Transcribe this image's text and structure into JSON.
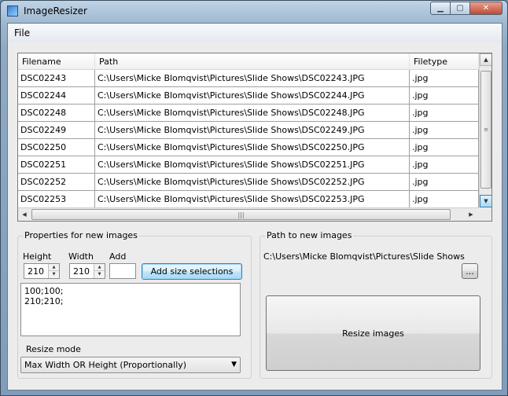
{
  "window": {
    "title": "ImageResizer",
    "min_glyph": "▁",
    "max_glyph": "▢",
    "close_glyph": "✕"
  },
  "menu": {
    "file_label": "File"
  },
  "grid": {
    "columns": [
      "Filename",
      "Path",
      "Filetype"
    ],
    "rows": [
      [
        "DSC02243",
        "C:\\Users\\Micke Blomqvist\\Pictures\\Slide Shows\\DSC02243.JPG",
        ".jpg"
      ],
      [
        "DSC02244",
        "C:\\Users\\Micke Blomqvist\\Pictures\\Slide Shows\\DSC02244.JPG",
        ".jpg"
      ],
      [
        "DSC02248",
        "C:\\Users\\Micke Blomqvist\\Pictures\\Slide Shows\\DSC02248.JPG",
        ".jpg"
      ],
      [
        "DSC02249",
        "C:\\Users\\Micke Blomqvist\\Pictures\\Slide Shows\\DSC02249.JPG",
        ".jpg"
      ],
      [
        "DSC02250",
        "C:\\Users\\Micke Blomqvist\\Pictures\\Slide Shows\\DSC02250.JPG",
        ".jpg"
      ],
      [
        "DSC02251",
        "C:\\Users\\Micke Blomqvist\\Pictures\\Slide Shows\\DSC02251.JPG",
        ".jpg"
      ],
      [
        "DSC02252",
        "C:\\Users\\Micke Blomqvist\\Pictures\\Slide Shows\\DSC02252.JPG",
        ".jpg"
      ],
      [
        "DSC02253",
        "C:\\Users\\Micke Blomqvist\\Pictures\\Slide Shows\\DSC02253.JPG",
        ".jpg"
      ]
    ]
  },
  "properties": {
    "group_title": "Properties for new images",
    "height_label": "Height",
    "width_label": "Width",
    "add_label": "Add",
    "height_value": "210",
    "width_value": "210",
    "add_value": "",
    "add_button": "Add size selections",
    "sizes_text": "100;100;\n210;210;",
    "resize_mode_label": "Resize mode",
    "resize_mode_value": "Max Width OR Height (Proportionally)"
  },
  "path": {
    "group_title": "Path to new images",
    "value": "C:\\Users\\Micke Blomqvist\\Pictures\\Slide Shows",
    "browse_label": "...",
    "resize_button": "Resize images"
  },
  "colors": {
    "focus_border": "#3c7fb1",
    "close_button": "#c24a33"
  }
}
